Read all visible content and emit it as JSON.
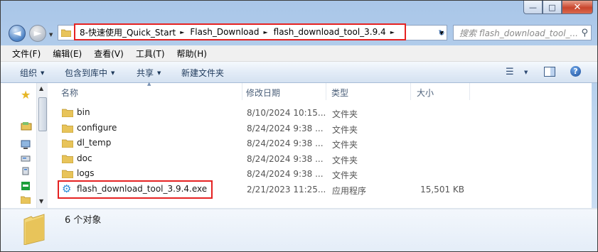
{
  "window": {
    "caption": {
      "minimize": "—",
      "maximize": "□",
      "close": "✕"
    }
  },
  "nav": {
    "back": "◄",
    "forward": "►",
    "dropdown": "▼"
  },
  "address": {
    "breadcrumbs": [
      "8-快速使用_Quick_Start",
      "Flash_Download",
      "flash_download_tool_3.9.4"
    ],
    "separator": "►",
    "dropdown": "▼",
    "refresh": "↻"
  },
  "search": {
    "placeholder": "搜索 flash_download_tool_...",
    "icon": "search-icon"
  },
  "menu": [
    "文件(F)",
    "编辑(E)",
    "查看(V)",
    "工具(T)",
    "帮助(H)"
  ],
  "toolbar": {
    "organize": "组织",
    "include_in_library": "包含到库中",
    "share": "共享",
    "new_folder": "新建文件夹",
    "help": "?"
  },
  "columns": {
    "name": "名称",
    "modified": "修改日期",
    "type": "类型",
    "size": "大小"
  },
  "files": [
    {
      "name": "bin",
      "modified": "8/10/2024 10:15...",
      "type": "文件夹",
      "size": "",
      "icon": "folder-icon"
    },
    {
      "name": "configure",
      "modified": "8/24/2024 9:38 ...",
      "type": "文件夹",
      "size": "",
      "icon": "folder-icon"
    },
    {
      "name": "dl_temp",
      "modified": "8/24/2024 9:38 ...",
      "type": "文件夹",
      "size": "",
      "icon": "folder-icon"
    },
    {
      "name": "doc",
      "modified": "8/24/2024 9:38 ...",
      "type": "文件夹",
      "size": "",
      "icon": "folder-icon"
    },
    {
      "name": "logs",
      "modified": "8/24/2024 9:38 ...",
      "type": "文件夹",
      "size": "",
      "icon": "folder-icon"
    },
    {
      "name": "flash_download_tool_3.9.4.exe",
      "modified": "2/21/2023 11:25...",
      "type": "应用程序",
      "size": "15,501 KB",
      "icon": "gear-icon"
    }
  ],
  "status": {
    "count": "6 个对象"
  },
  "colors": {
    "highlight": "#e52222",
    "folder": "#e8c45a",
    "accent": "#1e395b"
  }
}
